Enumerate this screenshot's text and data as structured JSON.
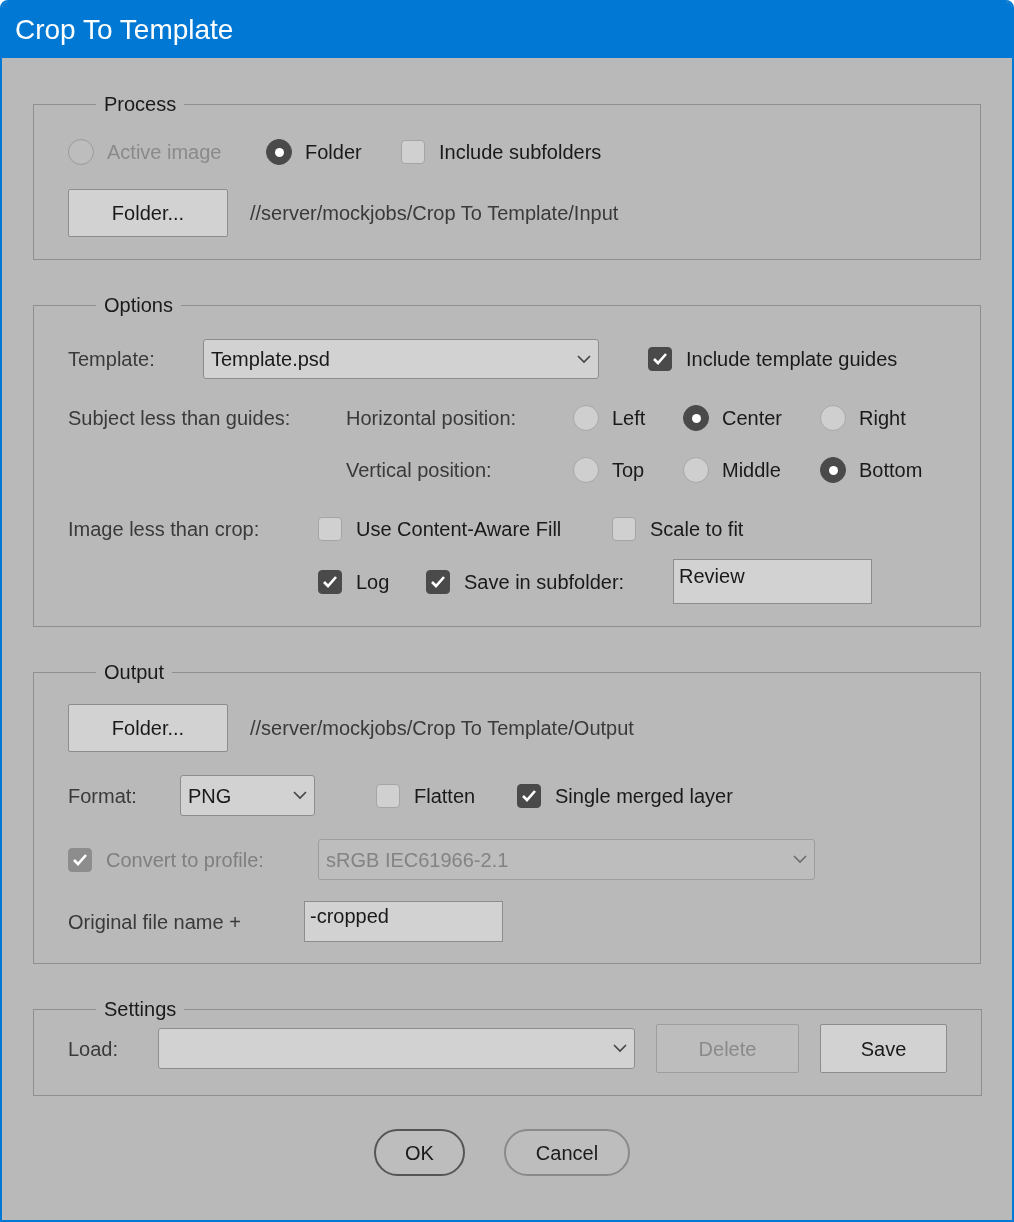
{
  "window": {
    "title": "Crop To Template"
  },
  "process": {
    "legend": "Process",
    "source": [
      {
        "label": "Active image",
        "selected": false,
        "disabled": true
      },
      {
        "label": "Folder",
        "selected": true,
        "disabled": false
      }
    ],
    "include_subfolders": {
      "label": "Include subfolders",
      "checked": false
    },
    "folder_button": "Folder...",
    "path": "//server/mockjobs/Crop To Template/Input"
  },
  "options": {
    "legend": "Options",
    "template_label": "Template:",
    "template": "Template.psd",
    "include_guides": {
      "label": "Include template guides",
      "checked": true
    },
    "subject_label": "Subject less than guides:",
    "horizontal": {
      "label": "Horizontal position:",
      "choices": [
        {
          "label": "Left",
          "selected": false
        },
        {
          "label": "Center",
          "selected": true
        },
        {
          "label": "Right",
          "selected": false
        }
      ]
    },
    "vertical": {
      "label": "Vertical position:",
      "choices": [
        {
          "label": "Top",
          "selected": false
        },
        {
          "label": "Middle",
          "selected": false
        },
        {
          "label": "Bottom",
          "selected": true
        }
      ]
    },
    "image_label": "Image less than crop:",
    "content_aware": {
      "label": "Use Content-Aware Fill",
      "checked": false
    },
    "scale_to_fit": {
      "label": "Scale to fit",
      "checked": false
    },
    "log": {
      "label": "Log",
      "checked": true
    },
    "save_in_subfolder": {
      "label": "Save in subfolder:",
      "checked": true
    },
    "subfolder": "Review"
  },
  "output": {
    "legend": "Output",
    "folder_button": "Folder...",
    "path": "//server/mockjobs/Crop To Template/Output",
    "format_label": "Format:",
    "format": "PNG",
    "flatten": {
      "label": "Flatten",
      "checked": false
    },
    "single_merged_layer": {
      "label": "Single merged layer",
      "checked": true
    },
    "convert_to_profile": {
      "label": "Convert to profile:",
      "checked": true,
      "disabled": true
    },
    "profile": "sRGB IEC61966-2.1",
    "name_label": "Original file name +",
    "suffix": "-cropped"
  },
  "settings": {
    "legend": "Settings",
    "load_label": "Load:",
    "buttons": [
      {
        "label": "Delete",
        "disabled": true
      },
      {
        "label": "Save",
        "disabled": false
      }
    ]
  },
  "buttons": [
    {
      "label": "OK",
      "kind": "default"
    },
    {
      "label": "Cancel",
      "kind": "normal"
    }
  ]
}
